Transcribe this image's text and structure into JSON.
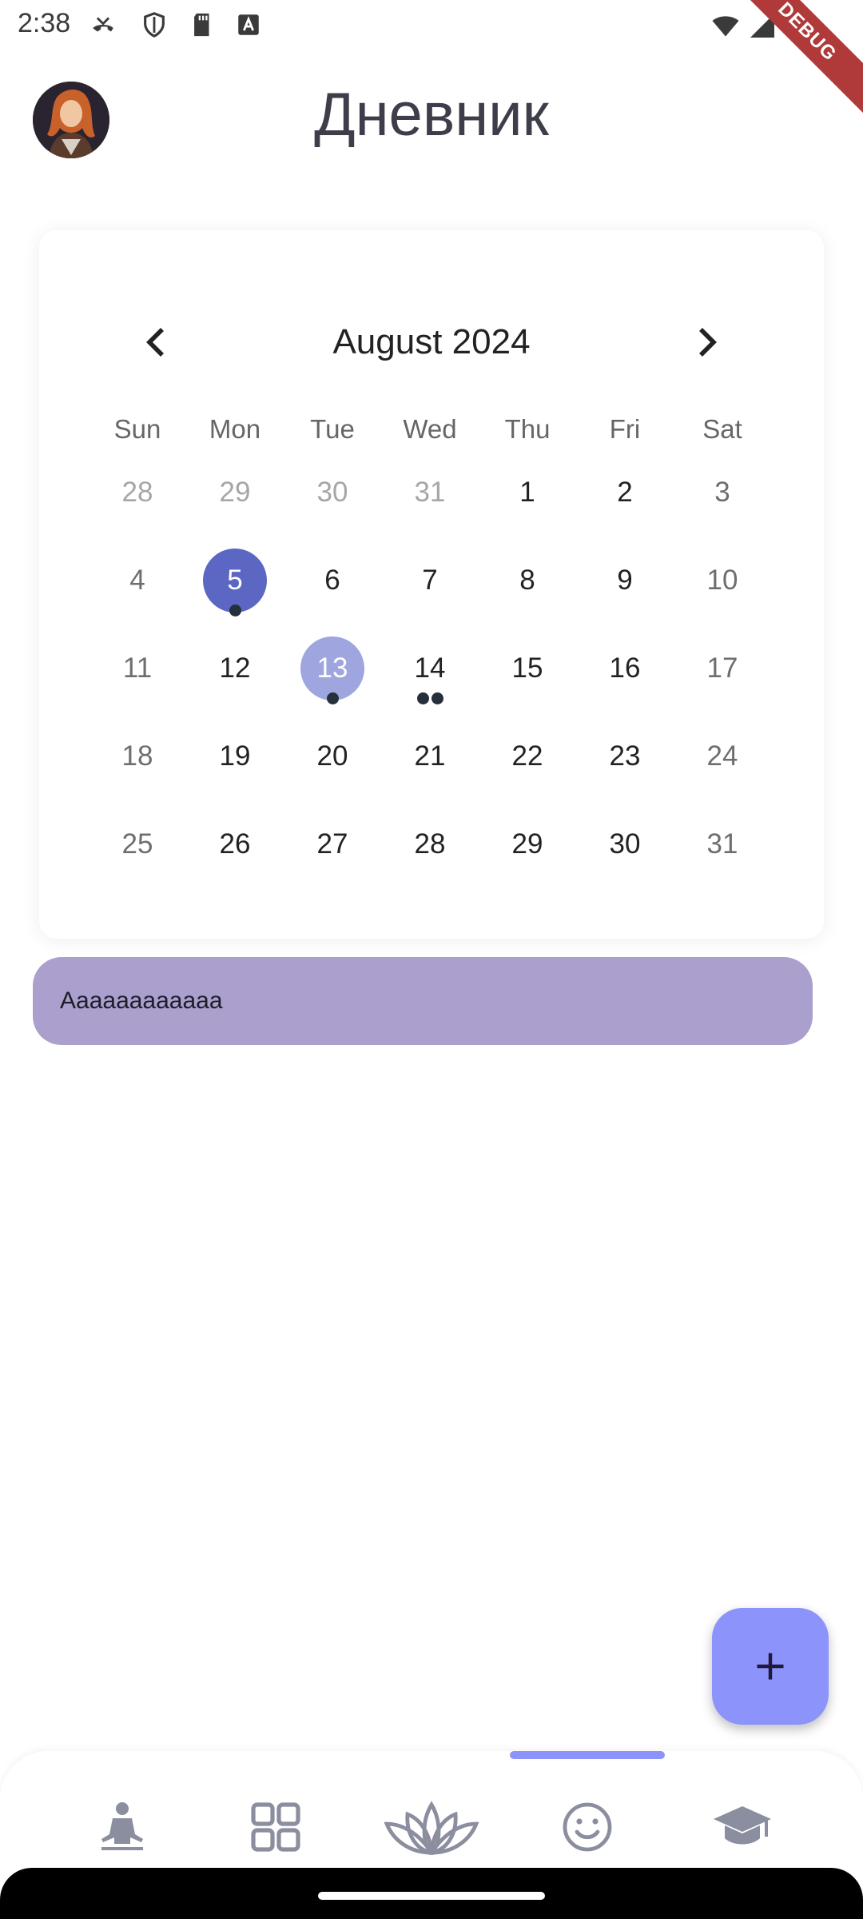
{
  "status_bar": {
    "time": "2:38",
    "debug_label": "DEBUG",
    "icons": [
      "missed-call-icon",
      "shield-icon",
      "sd-card-icon",
      "a-notification-icon",
      "wifi-icon",
      "signal-icon"
    ]
  },
  "header": {
    "title": "Дневник",
    "avatar": "user-avatar"
  },
  "calendar": {
    "month_label": "August 2024",
    "prev_icon": "chevron-left-icon",
    "next_icon": "chevron-right-icon",
    "weekdays": [
      "Sun",
      "Mon",
      "Tue",
      "Wed",
      "Thu",
      "Fri",
      "Sat"
    ],
    "weeks": [
      [
        "28",
        "29",
        "30",
        "31",
        "1",
        "2",
        "3"
      ],
      [
        "4",
        "5",
        "6",
        "7",
        "8",
        "9",
        "10"
      ],
      [
        "11",
        "12",
        "13",
        "14",
        "15",
        "16",
        "17"
      ],
      [
        "18",
        "19",
        "20",
        "21",
        "22",
        "23",
        "24"
      ],
      [
        "25",
        "26",
        "27",
        "28",
        "29",
        "30",
        "31"
      ]
    ],
    "selected_day": "5",
    "today_day": "13",
    "event_markers": {
      "5": 1,
      "13": 1,
      "14": 2
    }
  },
  "notes": [
    {
      "text": "Aaaaaaaaaaaa"
    }
  ],
  "fab": {
    "icon": "plus-icon"
  },
  "bottom_nav": {
    "items": [
      "meditation-icon",
      "grid-icon",
      "lotus-icon",
      "smiley-icon",
      "graduation-cap-icon"
    ],
    "active_index": 3
  },
  "colors": {
    "selected": "#5b67c2",
    "today": "#9ea5df",
    "note": "#aba0cd",
    "fab": "#8c93fb",
    "nav_icon": "#8a8e9e"
  }
}
